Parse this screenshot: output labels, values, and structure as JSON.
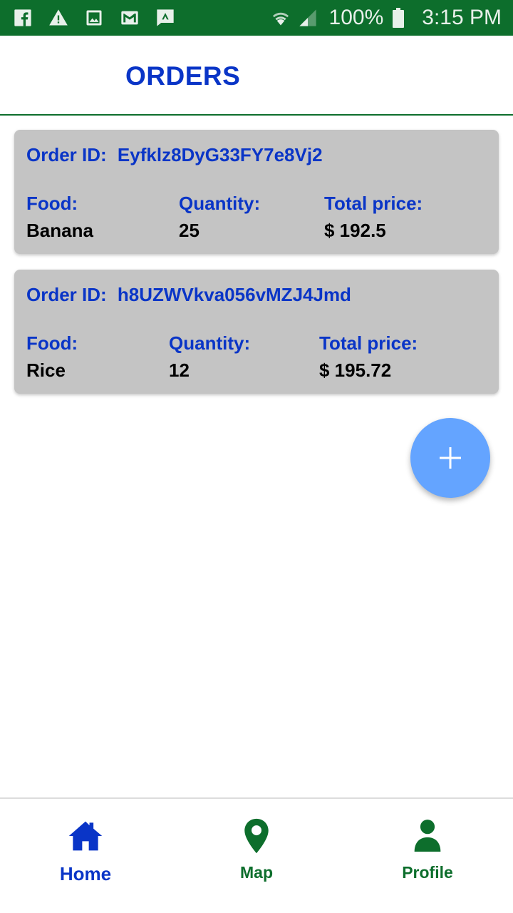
{
  "status_bar": {
    "battery_percent": "100%",
    "time": "3:15 PM",
    "left_icons": [
      "facebook-icon",
      "warning-icon",
      "image-icon",
      "gmail-icon",
      "message-icon"
    ],
    "right_icons": [
      "wifi-icon",
      "signal-icon",
      "battery-icon"
    ],
    "background_color": "#0d6e2c"
  },
  "header": {
    "title": "ORDERS",
    "title_color": "#0a35c7"
  },
  "orders": [
    {
      "id_label": "Order ID:",
      "id": "Eyfklz8DyG33FY7e8Vj2",
      "food_label": "Food:",
      "food": "Banana",
      "quantity_label": "Quantity:",
      "quantity": "25",
      "price_label": "Total price:",
      "price": "$ 192.5"
    },
    {
      "id_label": "Order ID:",
      "id": "h8UZWVkva056vMZJ4Jmd",
      "food_label": "Food:",
      "food": "Rice",
      "quantity_label": "Quantity:",
      "quantity": "12",
      "price_label": "Total price:",
      "price": "$ 195.72"
    }
  ],
  "fab": {
    "icon": "plus-icon",
    "color": "#64a4ff"
  },
  "bottom_nav": {
    "items": [
      {
        "label": "Home",
        "icon": "home-icon",
        "active": true,
        "color": "#0a35c7"
      },
      {
        "label": "Map",
        "icon": "map-pin-icon",
        "active": false,
        "color": "#0d6e2c"
      },
      {
        "label": "Profile",
        "icon": "person-icon",
        "active": false,
        "color": "#0d6e2c"
      }
    ]
  }
}
